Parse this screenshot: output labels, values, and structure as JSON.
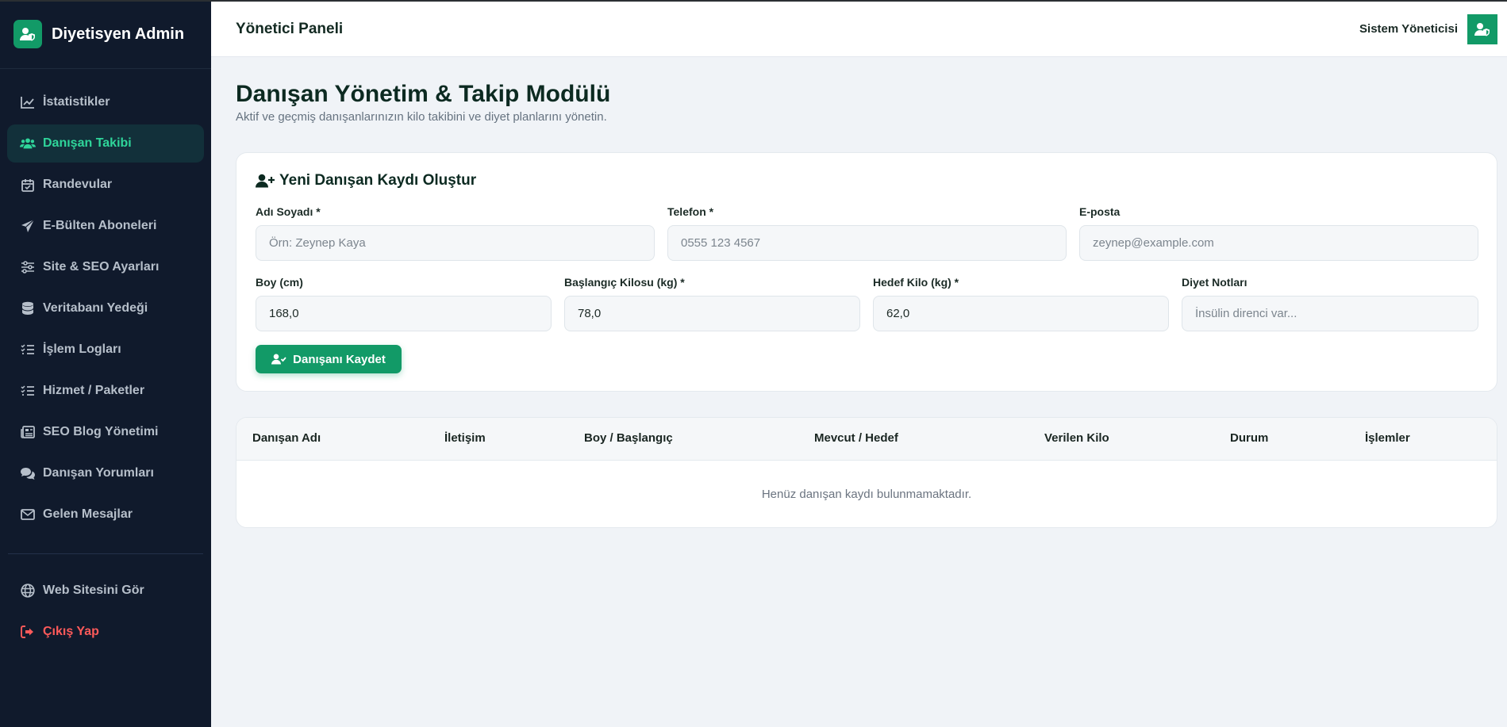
{
  "brand": {
    "title": "Diyetisyen Admin",
    "icon": "user-shield-icon"
  },
  "sidebar": {
    "items": [
      {
        "label": "İstatistikler",
        "icon": "chart-line-icon",
        "active": false
      },
      {
        "label": "Danışan Takibi",
        "icon": "users-icon",
        "active": true
      },
      {
        "label": "Randevular",
        "icon": "calendar-check-icon",
        "active": false
      },
      {
        "label": "E-Bülten Aboneleri",
        "icon": "paper-plane-icon",
        "active": false
      },
      {
        "label": "Site & SEO Ayarları",
        "icon": "sliders-icon",
        "active": false
      },
      {
        "label": "Veritabanı Yedeği",
        "icon": "database-icon",
        "active": false
      },
      {
        "label": "İşlem Logları",
        "icon": "list-check-icon",
        "active": false
      },
      {
        "label": "Hizmet / Paketler",
        "icon": "list-check-icon",
        "active": false
      },
      {
        "label": "SEO Blog Yönetimi",
        "icon": "newspaper-icon",
        "active": false
      },
      {
        "label": "Danışan Yorumları",
        "icon": "comments-icon",
        "active": false
      },
      {
        "label": "Gelen Mesajlar",
        "icon": "envelope-icon",
        "active": false
      }
    ],
    "bottom": [
      {
        "label": "Web Sitesini Gör",
        "icon": "globe-icon"
      },
      {
        "label": "Çıkış Yap",
        "icon": "sign-out-icon"
      }
    ]
  },
  "header": {
    "title": "Yönetici Paneli",
    "user_name": "Sistem Yöneticisi",
    "avatar_icon": "user-shield-icon"
  },
  "main": {
    "title": "Danışan Yönetim & Takip Modülü",
    "subtitle": "Aktif ve geçmiş danışanlarınızın kilo takibini ve diyet planlarını yönetin."
  },
  "form": {
    "title": "Yeni Danışan Kaydı Oluştur",
    "title_icon": "user-plus-icon",
    "fields": {
      "name": {
        "label": "Adı Soyadı *",
        "placeholder": "Örn: Zeynep Kaya",
        "value": ""
      },
      "phone": {
        "label": "Telefon *",
        "placeholder": "0555 123 4567",
        "value": ""
      },
      "email": {
        "label": "E-posta",
        "placeholder": "zeynep@example.com",
        "value": ""
      },
      "height": {
        "label": "Boy (cm)",
        "placeholder": "",
        "value": "168,0"
      },
      "start_weight": {
        "label": "Başlangıç Kilosu (kg) *",
        "placeholder": "",
        "value": "78,0"
      },
      "target_weight": {
        "label": "Hedef Kilo (kg) *",
        "placeholder": "",
        "value": "62,0"
      },
      "notes": {
        "label": "Diyet Notları",
        "placeholder": "İnsülin direnci var...",
        "value": ""
      }
    },
    "save_label": "Danışanı Kaydet",
    "save_icon": "user-check-icon"
  },
  "table": {
    "columns": [
      "Danışan Adı",
      "İletişim",
      "Boy / Başlangıç",
      "Mevcut / Hedef",
      "Verilen Kilo",
      "Durum",
      "İşlemler"
    ],
    "rows": [],
    "empty_text": "Henüz danışan kaydı bulunmamaktadır."
  },
  "colors": {
    "accent": "#129a67",
    "sidebar_bg": "#101a2c",
    "active_text": "#2fd59a",
    "logout": "#ff5a5a",
    "page_bg": "#f0f3f7"
  }
}
